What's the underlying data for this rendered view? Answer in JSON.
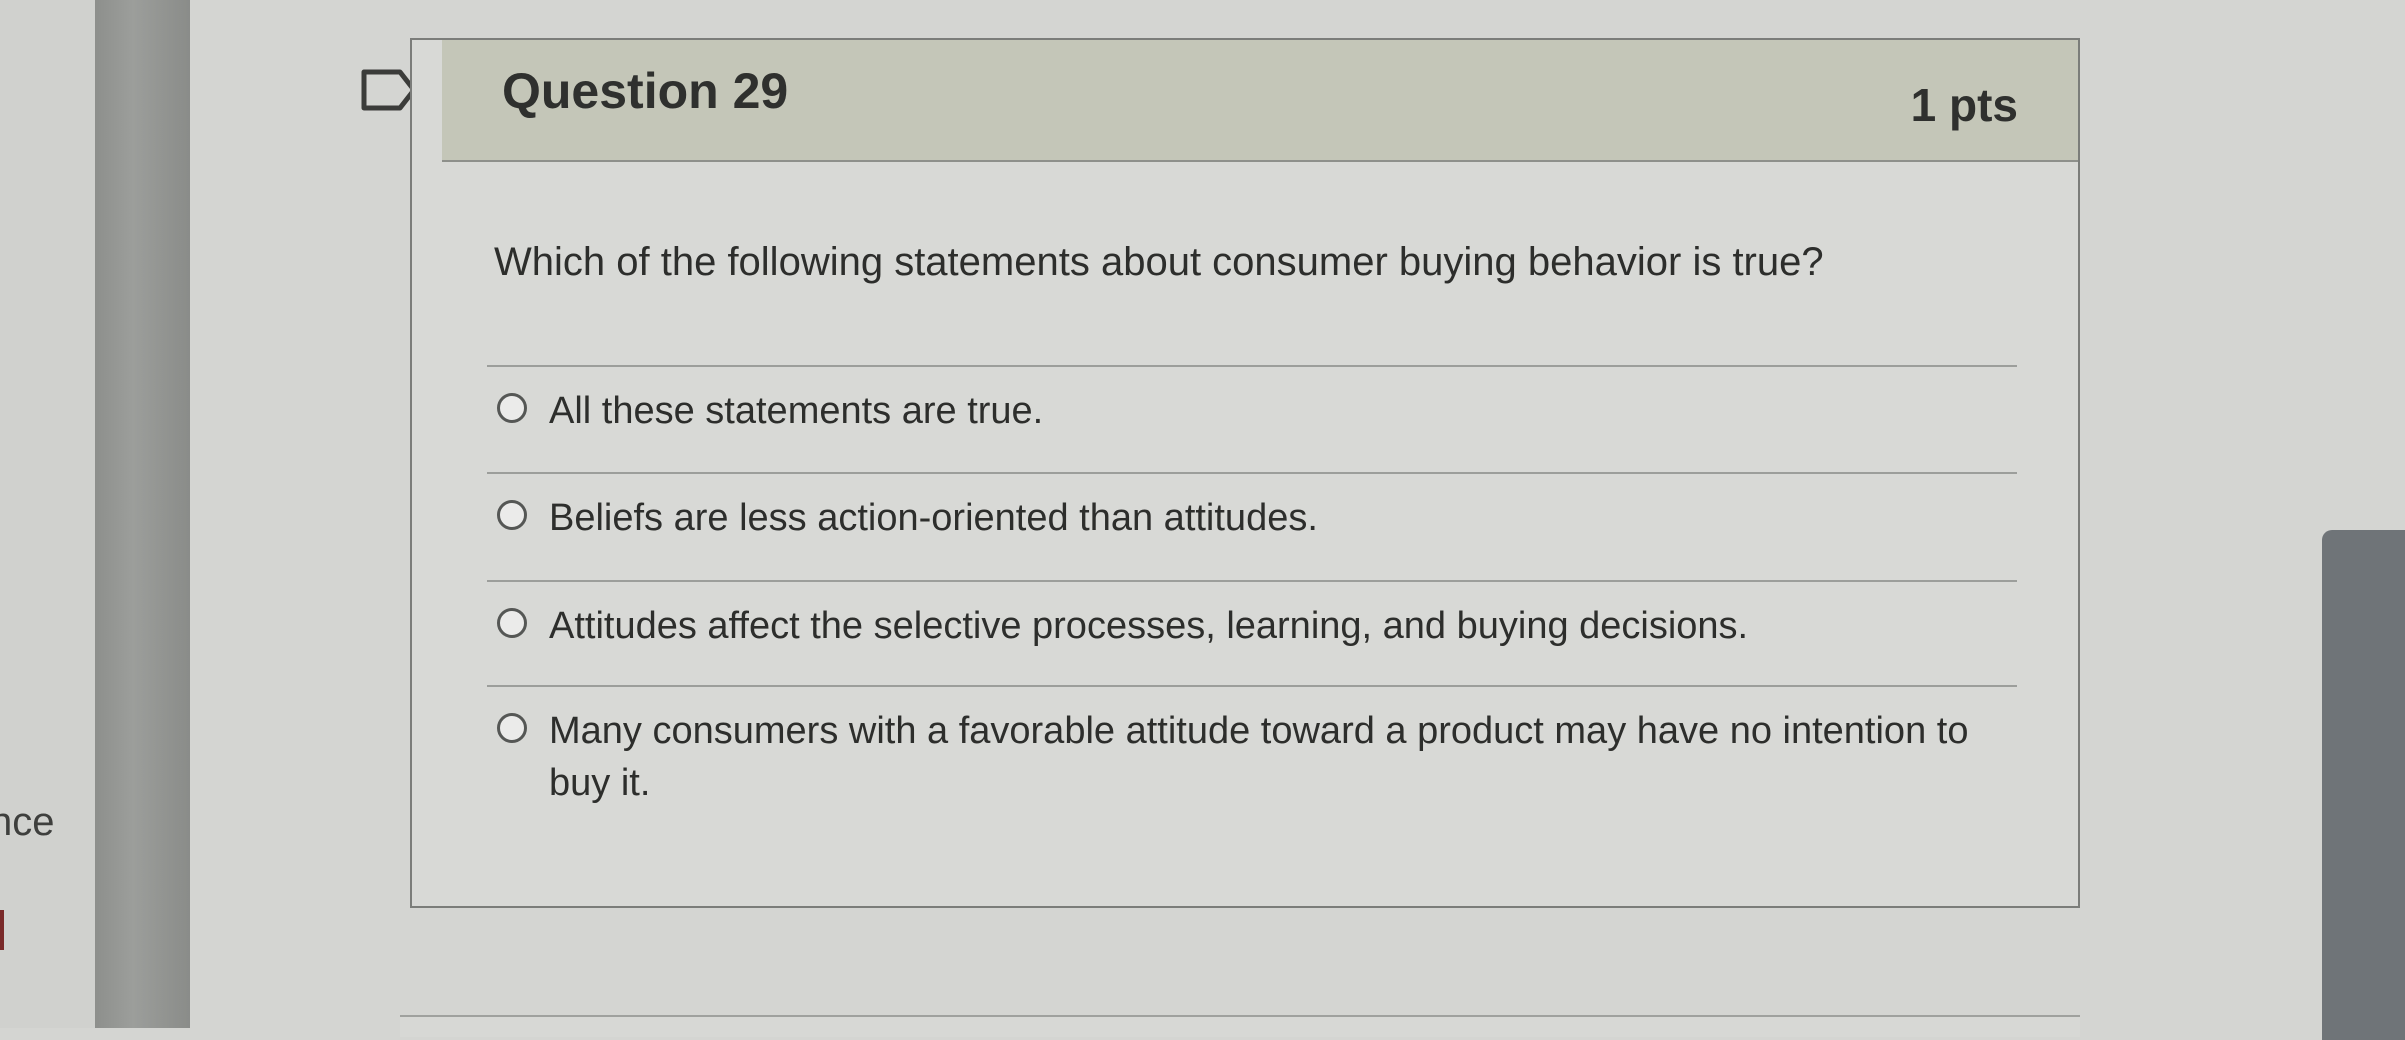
{
  "question": {
    "title": "Question 29",
    "points": "1 pts",
    "prompt": "Which of the following statements about consumer buying behavior is true?",
    "options": [
      "All these statements are true.",
      "Beliefs are less action-oriented than attitudes.",
      "Attitudes affect the selective processes, learning, and buying decisions.",
      "Many consumers with a favorable attitude toward a product may have no intention to buy it."
    ]
  },
  "sidebar": {
    "cut_text": "nce"
  },
  "icons": {
    "flag": "bookmark-flag-icon",
    "radio": "radio-unselected-icon"
  },
  "colors": {
    "header_bg": "#c4c6b8",
    "page_bg": "#d4d5d2",
    "text": "#2d2e2c"
  }
}
